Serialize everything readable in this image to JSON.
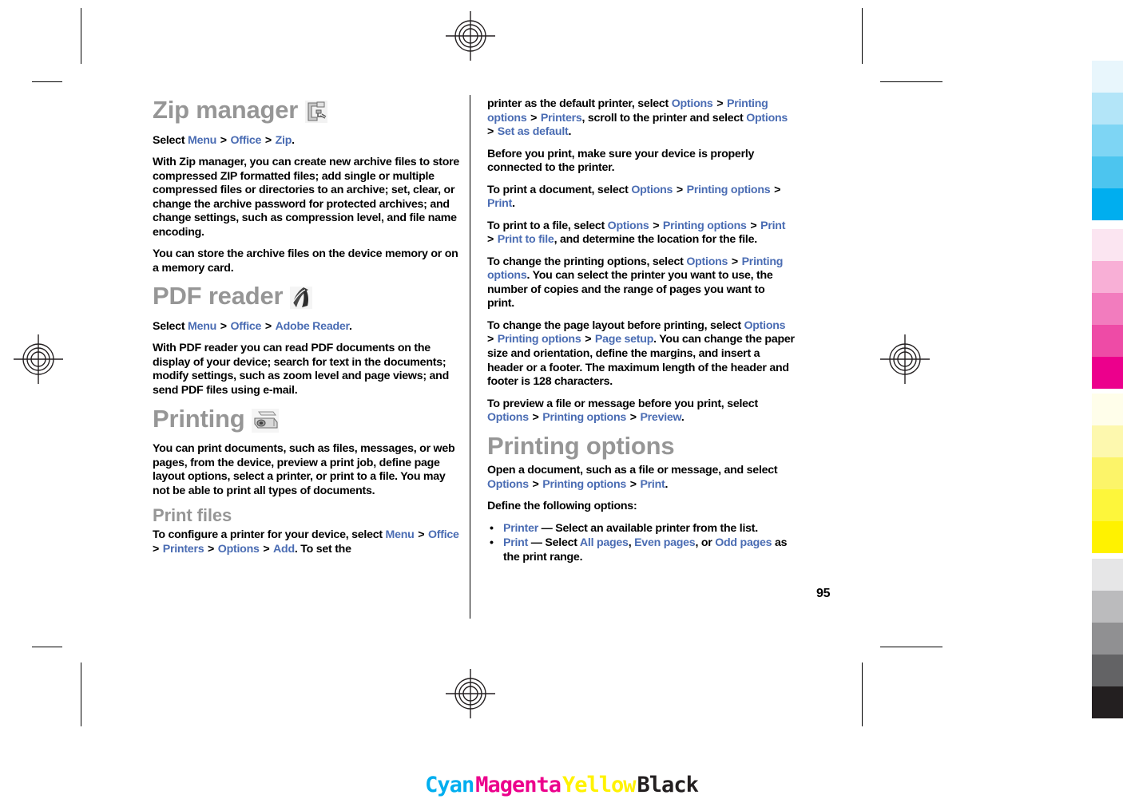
{
  "document": {
    "page_number": "95",
    "columns": {
      "left": {
        "blocks": [
          {
            "type": "h1",
            "text": "Zip manager",
            "icon": "zip-clamp-icon"
          },
          {
            "type": "p",
            "runs": [
              {
                "t": "Select ",
                "s": "plain"
              },
              {
                "t": "Menu",
                "s": "menu"
              },
              {
                "t": " > ",
                "s": "sep"
              },
              {
                "t": "Office",
                "s": "menu"
              },
              {
                "t": " > ",
                "s": "sep"
              },
              {
                "t": "Zip",
                "s": "menu"
              },
              {
                "t": ".",
                "s": "plain"
              }
            ]
          },
          {
            "type": "p",
            "runs": [
              {
                "t": "With Zip manager, you can create new archive files to store compressed ZIP formatted files; add single or multiple compressed files or directories to an archive; set, clear, or change the archive password for protected archives; and change settings, such as compression level, and file name encoding.",
                "s": "plain"
              }
            ]
          },
          {
            "type": "p",
            "runs": [
              {
                "t": "You can store the archive files on the device memory or on a memory card.",
                "s": "plain"
              }
            ]
          },
          {
            "type": "h1",
            "text": "PDF reader",
            "icon": "pdf-reader-icon"
          },
          {
            "type": "p",
            "runs": [
              {
                "t": "Select ",
                "s": "plain"
              },
              {
                "t": "Menu",
                "s": "menu"
              },
              {
                "t": " > ",
                "s": "sep"
              },
              {
                "t": "Office",
                "s": "menu"
              },
              {
                "t": " > ",
                "s": "sep"
              },
              {
                "t": "Adobe Reader",
                "s": "menu"
              },
              {
                "t": ".",
                "s": "plain"
              }
            ]
          },
          {
            "type": "p",
            "runs": [
              {
                "t": "With PDF reader you can read PDF documents on the display of your device; search for text in the documents; modify settings, such as zoom level and page views; and send PDF files using e-mail.",
                "s": "plain"
              }
            ]
          },
          {
            "type": "h1",
            "text": "Printing",
            "icon": "printer-icon"
          },
          {
            "type": "p",
            "runs": [
              {
                "t": "You can print documents, such as files, messages, or web pages, from the device, preview a print job, define page layout options, select a printer, or print to a file. You may not be able to print all types of documents.",
                "s": "plain"
              }
            ]
          },
          {
            "type": "h2",
            "text": "Print files"
          },
          {
            "type": "p",
            "runs": [
              {
                "t": "To configure a printer for your device, select ",
                "s": "plain"
              },
              {
                "t": "Menu",
                "s": "menu"
              },
              {
                "t": " > ",
                "s": "sep"
              },
              {
                "t": "Office",
                "s": "menu"
              },
              {
                "t": " > ",
                "s": "sep"
              },
              {
                "t": "Printers",
                "s": "menu"
              },
              {
                "t": " > ",
                "s": "sep"
              },
              {
                "t": "Options",
                "s": "menu"
              },
              {
                "t": " > ",
                "s": "sep"
              },
              {
                "t": "Add",
                "s": "menu"
              },
              {
                "t": ". To set the",
                "s": "plain"
              }
            ]
          }
        ]
      },
      "right": {
        "blocks": [
          {
            "type": "p",
            "runs": [
              {
                "t": "printer as the default printer, select ",
                "s": "plain"
              },
              {
                "t": "Options",
                "s": "menu"
              },
              {
                "t": " > ",
                "s": "sep"
              },
              {
                "t": "Printing options",
                "s": "menu"
              },
              {
                "t": " > ",
                "s": "sep"
              },
              {
                "t": "Printers",
                "s": "menu"
              },
              {
                "t": ", scroll to the printer and select ",
                "s": "plain"
              },
              {
                "t": "Options",
                "s": "menu"
              },
              {
                "t": " > ",
                "s": "sep"
              },
              {
                "t": "Set as default",
                "s": "menu"
              },
              {
                "t": ".",
                "s": "plain"
              }
            ]
          },
          {
            "type": "p",
            "runs": [
              {
                "t": "Before you print, make sure your device is properly connected to the printer.",
                "s": "plain"
              }
            ]
          },
          {
            "type": "p",
            "runs": [
              {
                "t": "To print a document, select ",
                "s": "plain"
              },
              {
                "t": "Options",
                "s": "menu"
              },
              {
                "t": " > ",
                "s": "sep"
              },
              {
                "t": "Printing options",
                "s": "menu"
              },
              {
                "t": " > ",
                "s": "sep"
              },
              {
                "t": "Print",
                "s": "menu"
              },
              {
                "t": ".",
                "s": "plain"
              }
            ]
          },
          {
            "type": "p",
            "runs": [
              {
                "t": "To print to a file, select ",
                "s": "plain"
              },
              {
                "t": "Options",
                "s": "menu"
              },
              {
                "t": " > ",
                "s": "sep"
              },
              {
                "t": "Printing options",
                "s": "menu"
              },
              {
                "t": " > ",
                "s": "sep"
              },
              {
                "t": "Print",
                "s": "menu"
              },
              {
                "t": " > ",
                "s": "sep"
              },
              {
                "t": "Print to file",
                "s": "menu"
              },
              {
                "t": ", and determine the location for the file.",
                "s": "plain"
              }
            ]
          },
          {
            "type": "p",
            "runs": [
              {
                "t": "To change the printing options, select ",
                "s": "plain"
              },
              {
                "t": "Options",
                "s": "menu"
              },
              {
                "t": " > ",
                "s": "sep"
              },
              {
                "t": "Printing options",
                "s": "menu"
              },
              {
                "t": ". You can select the printer you want to use, the number of copies and the range of pages you want to print.",
                "s": "plain"
              }
            ]
          },
          {
            "type": "p",
            "runs": [
              {
                "t": "To change the page layout before printing, select ",
                "s": "plain"
              },
              {
                "t": "Options",
                "s": "menu"
              },
              {
                "t": " > ",
                "s": "sep"
              },
              {
                "t": "Printing options",
                "s": "menu"
              },
              {
                "t": " > ",
                "s": "sep"
              },
              {
                "t": "Page setup",
                "s": "menu"
              },
              {
                "t": ". You can change the paper size and orientation, define the margins, and insert a header or a footer. The maximum length of the header and footer is 128 characters.",
                "s": "plain"
              }
            ]
          },
          {
            "type": "p",
            "runs": [
              {
                "t": "To preview a file or message before you print, select ",
                "s": "plain"
              },
              {
                "t": "Options",
                "s": "menu"
              },
              {
                "t": " > ",
                "s": "sep"
              },
              {
                "t": "Printing options",
                "s": "menu"
              },
              {
                "t": " > ",
                "s": "sep"
              },
              {
                "t": "Preview",
                "s": "menu"
              },
              {
                "t": ".",
                "s": "plain"
              }
            ]
          },
          {
            "type": "h1",
            "text": "Printing options"
          },
          {
            "type": "p",
            "runs": [
              {
                "t": "Open a document, such as a file or message, and select ",
                "s": "plain"
              },
              {
                "t": "Options",
                "s": "menu"
              },
              {
                "t": " > ",
                "s": "sep"
              },
              {
                "t": "Printing options",
                "s": "menu"
              },
              {
                "t": " > ",
                "s": "sep"
              },
              {
                "t": "Print",
                "s": "menu"
              },
              {
                "t": ".",
                "s": "plain"
              }
            ]
          },
          {
            "type": "p",
            "runs": [
              {
                "t": "Define the following options:",
                "s": "plain"
              }
            ]
          },
          {
            "type": "ul",
            "items": [
              {
                "runs": [
                  {
                    "t": "Printer",
                    "s": "menu"
                  },
                  {
                    "t": "  — Select an available printer from the list.",
                    "s": "plain"
                  }
                ]
              },
              {
                "runs": [
                  {
                    "t": "Print",
                    "s": "menu"
                  },
                  {
                    "t": "  — Select ",
                    "s": "plain"
                  },
                  {
                    "t": "All pages",
                    "s": "menu"
                  },
                  {
                    "t": ", ",
                    "s": "plain"
                  },
                  {
                    "t": "Even pages",
                    "s": "menu"
                  },
                  {
                    "t": ", or ",
                    "s": "plain"
                  },
                  {
                    "t": "Odd pages",
                    "s": "menu"
                  },
                  {
                    "t": " as the print range.",
                    "s": "plain"
                  }
                ]
              }
            ]
          }
        ]
      }
    }
  },
  "print_marks": {
    "cmyk_labels": [
      {
        "text": "Cyan",
        "color": "#00AEEF"
      },
      {
        "text": "Magenta",
        "color": "#EC008C"
      },
      {
        "text": "Yellow",
        "color": "#FFF200"
      },
      {
        "text": "Black",
        "color": "#231F20"
      }
    ],
    "calibration_bars": [
      {
        "name": "cyan",
        "swatches": [
          "#E8F6FC",
          "#B3E5F8",
          "#7ED5F4",
          "#4CC5EF",
          "#00AEEF"
        ]
      },
      {
        "name": "magenta",
        "swatches": [
          "#FBE5F1",
          "#F8AFD6",
          "#F27CBE",
          "#EE4BA6",
          "#EC008C"
        ]
      },
      {
        "name": "yellow",
        "swatches": [
          "#FFFEEA",
          "#FDF8AE",
          "#FCF469",
          "#FDF63B",
          "#FFF200"
        ]
      },
      {
        "name": "black",
        "swatches": [
          "#E6E6E7",
          "#BBBBBD",
          "#909092",
          "#636365",
          "#231F20"
        ]
      }
    ]
  },
  "colors": {
    "heading": "#969696",
    "menu_link": "#4A6CB3",
    "body_text": "#000000"
  }
}
